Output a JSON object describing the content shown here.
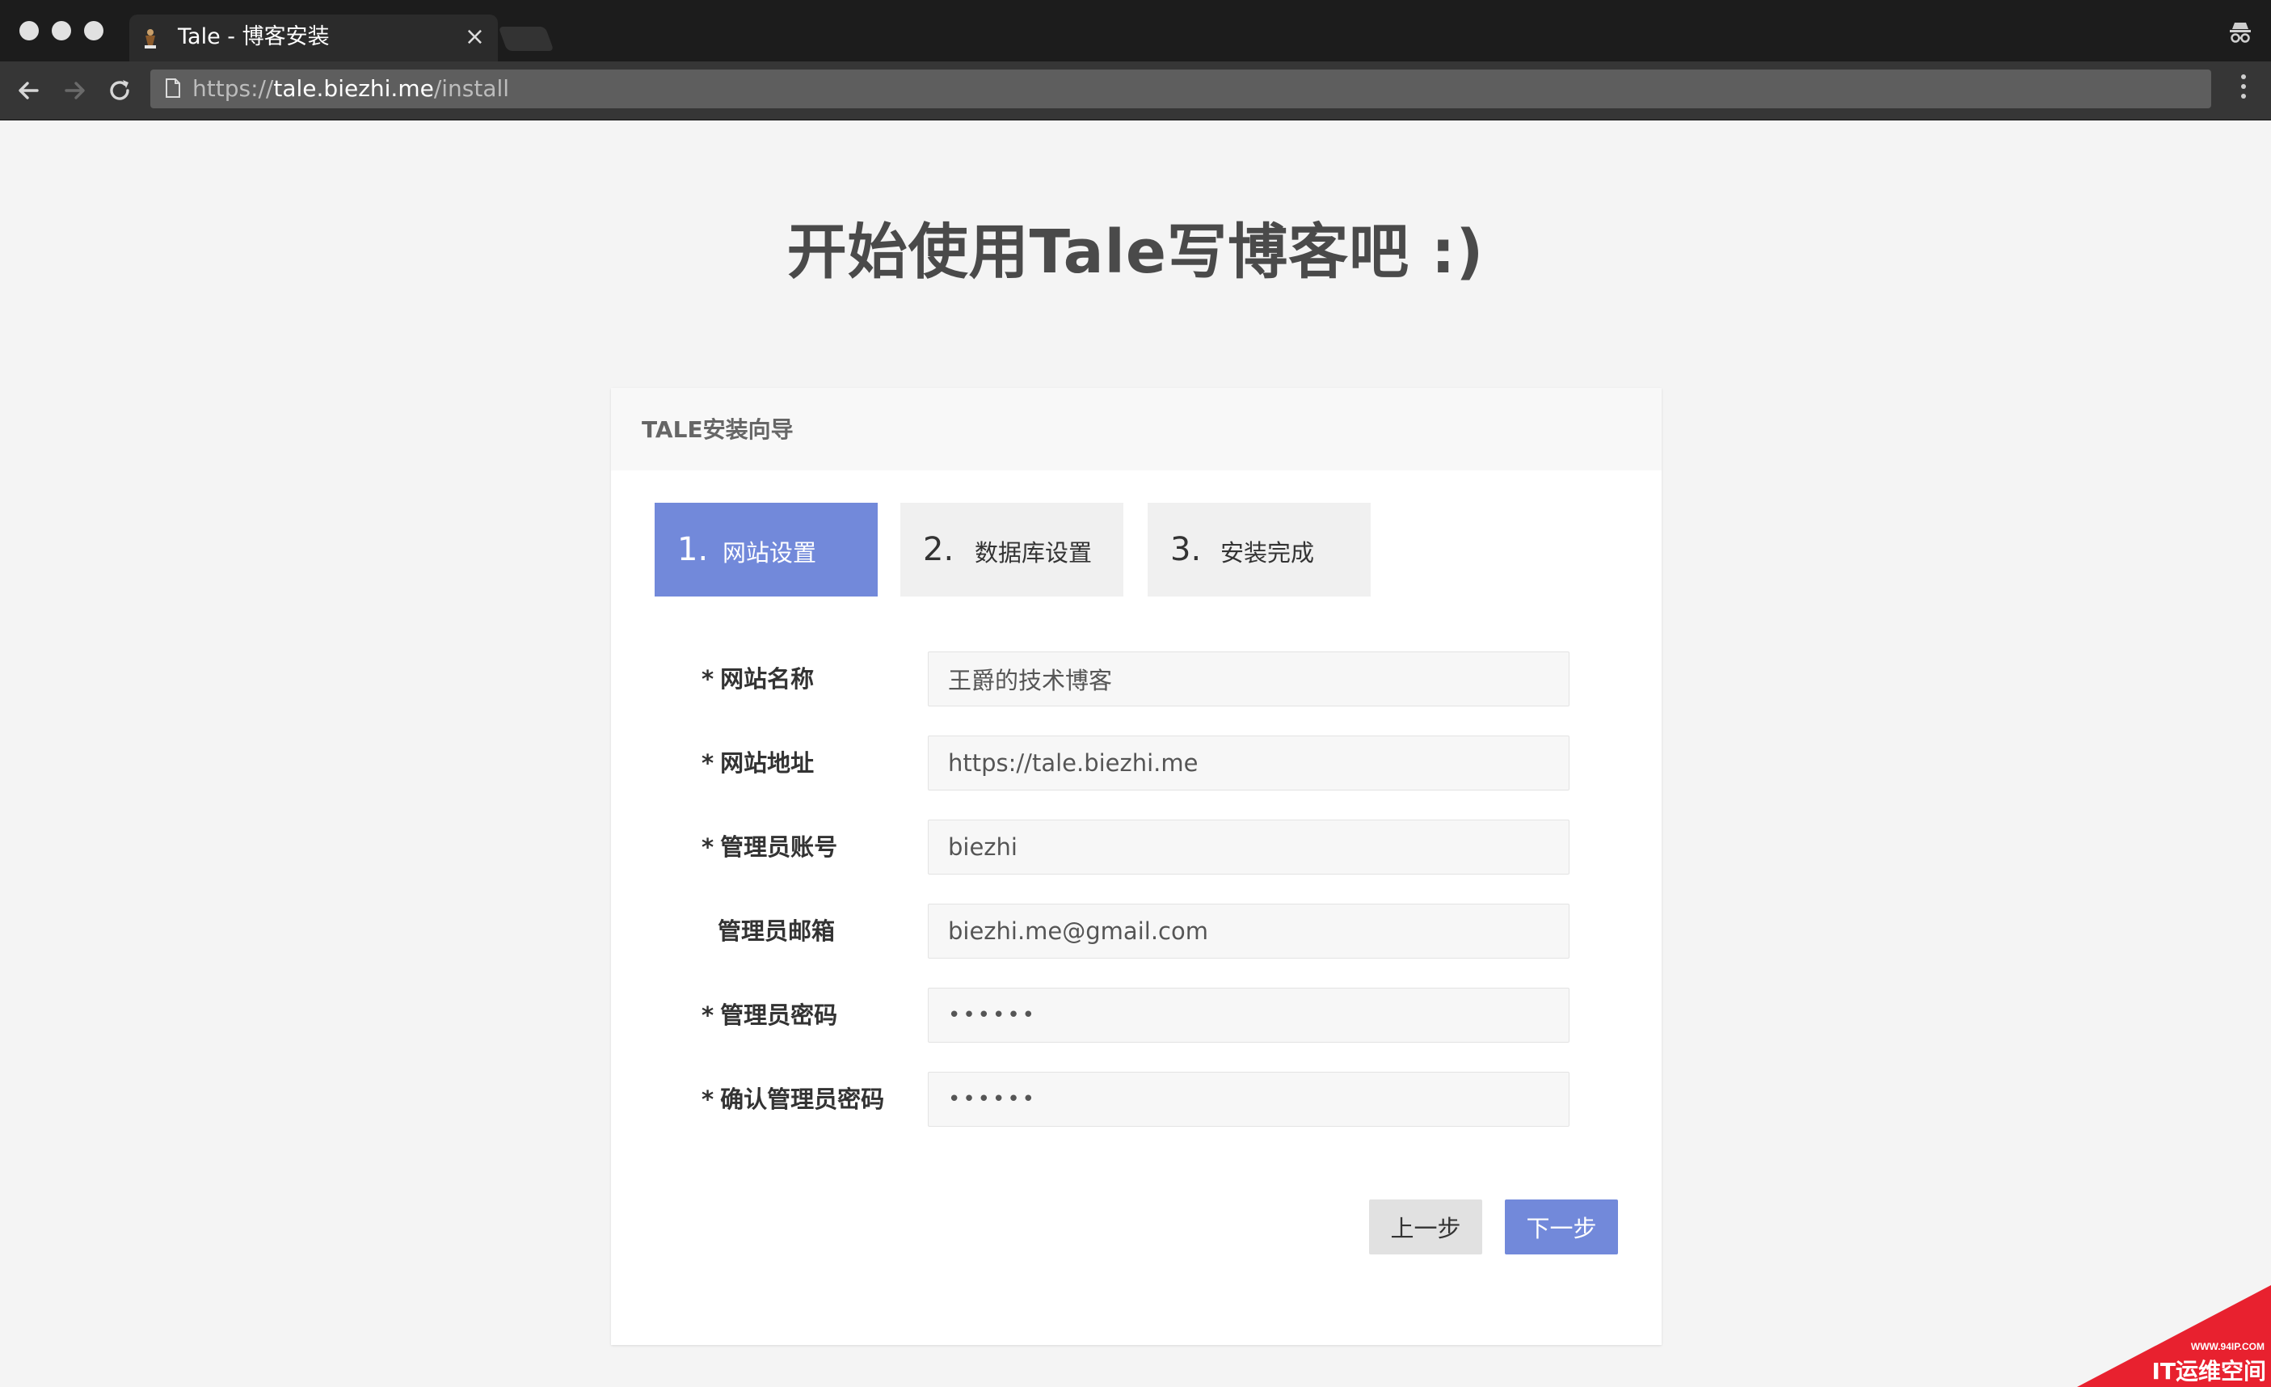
{
  "browser": {
    "tab_title": "Tale - 博客安装",
    "url": {
      "scheme": "https://",
      "host": "tale.biezhi.me",
      "path": "/install"
    }
  },
  "page": {
    "heading": "开始使用Tale写博客吧 :)"
  },
  "wizard": {
    "header": "TALE安装向导",
    "steps": [
      {
        "num": "1.",
        "label": "网站设置",
        "active": true
      },
      {
        "num": "2.",
        "label": "数据库设置",
        "active": false
      },
      {
        "num": "3.",
        "label": "安装完成",
        "active": false
      }
    ],
    "fields": [
      {
        "required": true,
        "required_mark": "*",
        "label": "网站名称",
        "value": "王爵的技术博客"
      },
      {
        "required": true,
        "required_mark": "*",
        "label": "网站地址",
        "value": "https://tale.biezhi.me"
      },
      {
        "required": true,
        "required_mark": "*",
        "label": "管理员账号",
        "value": "biezhi"
      },
      {
        "required": false,
        "required_mark": "",
        "label": "管理员邮箱",
        "value": "biezhi.me@gmail.com"
      },
      {
        "required": true,
        "required_mark": "*",
        "label": "管理员密码",
        "value": "••••••"
      },
      {
        "required": true,
        "required_mark": "*",
        "label": "确认管理员密码",
        "value": "••••••"
      }
    ],
    "prev_label": "上一步",
    "next_label": "下一步"
  },
  "watermark": {
    "line1": "WWW.94IP.COM",
    "line2": "IT运维空间"
  },
  "colors": {
    "accent": "#7289da",
    "page_bg": "#f4f4f4",
    "chrome_bg": "#1c1c1c"
  },
  "icons": [
    "close-icon",
    "incognito-icon",
    "back-arrow-icon",
    "forward-arrow-icon",
    "reload-icon",
    "document-icon",
    "more-vertical-icon",
    "tale-favicon-icon"
  ]
}
